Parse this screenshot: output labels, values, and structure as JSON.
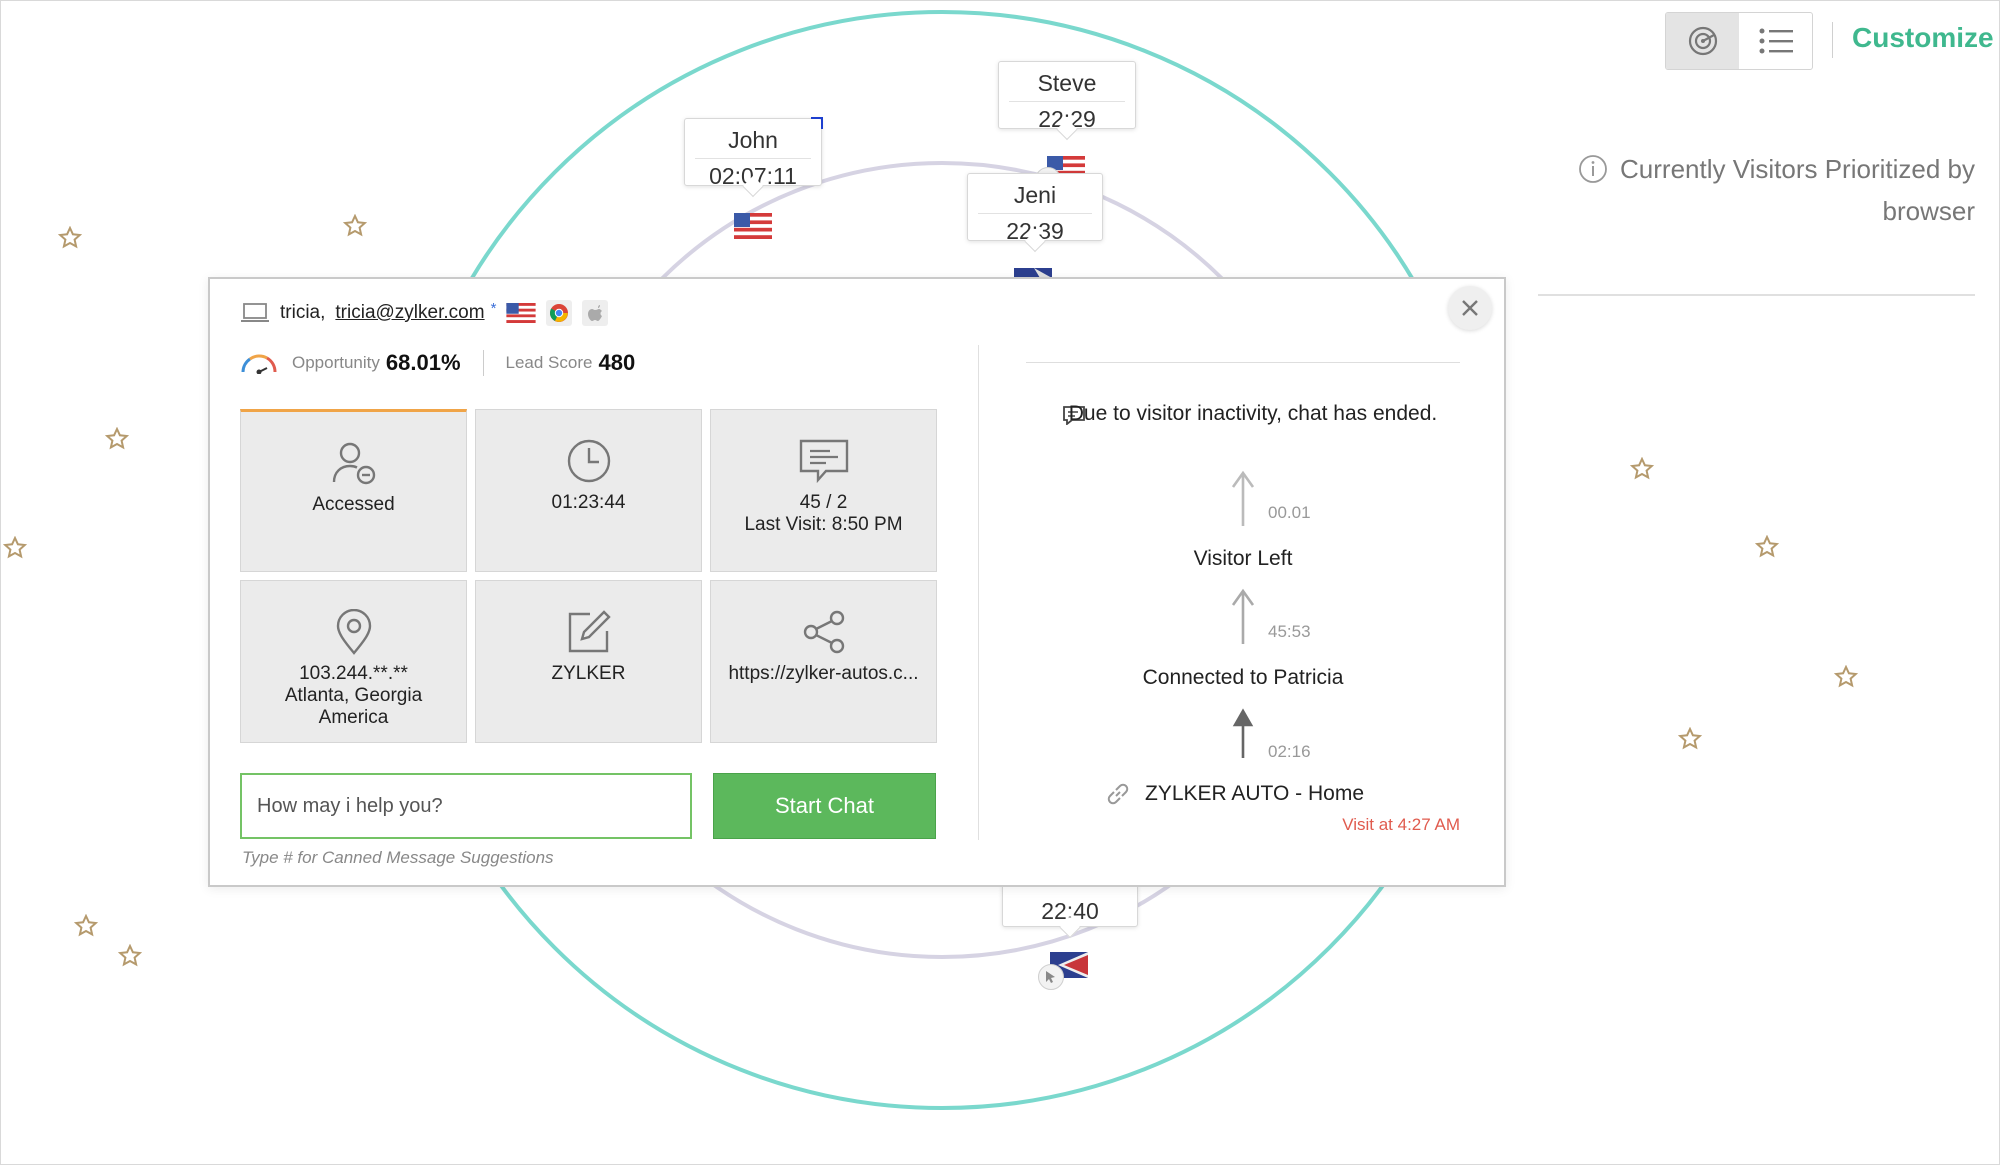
{
  "colors": {
    "accent": "#3fb88e",
    "outer_ring": "#7ad8cd",
    "inner_ring": "#d6d3e3",
    "start_chat": "#5cb85c",
    "input_border": "#74c365",
    "active_tile": "#f0a447",
    "visit_time": "#e05b4e"
  },
  "toolbar": {
    "customize_label": "Customize",
    "view_radar_icon": "radar-icon",
    "view_list_icon": "list-icon"
  },
  "priority": {
    "line1": "Currently Visitors Prioritized by",
    "line2": "browser",
    "icon": "info-icon"
  },
  "radar_visitors": [
    {
      "name": "John",
      "time": "02:07:11"
    },
    {
      "name": "Steve",
      "time": "22:29"
    },
    {
      "name": "Jeni",
      "time": "22:39"
    },
    {
      "name": "",
      "time": "22:40"
    }
  ],
  "visitor": {
    "name": "tricia,",
    "email": "tricia@zylker.com",
    "asterisk": "*",
    "device_icon": "laptop-icon",
    "flag_icon": "us-flag-icon",
    "browser_icon": "chrome-icon",
    "os_icon": "apple-icon"
  },
  "scores": {
    "opportunity_label": "Opportunity",
    "opportunity_value": "68.01%",
    "lead_label": "Lead Score",
    "lead_value": "480"
  },
  "tiles": [
    {
      "icon": "user-minus-icon",
      "lines": [
        "Accessed"
      ]
    },
    {
      "icon": "clock-icon",
      "lines": [
        "01:23:44"
      ]
    },
    {
      "icon": "chat-icon",
      "lines": [
        "45 / 2",
        "Last Visit: 8:50 PM"
      ]
    },
    {
      "icon": "location-icon",
      "lines": [
        "103.244.**.**",
        "Atlanta, Georgia",
        "America"
      ]
    },
    {
      "icon": "edit-icon",
      "lines": [
        "ZYLKER"
      ]
    },
    {
      "icon": "share-icon",
      "lines": [
        "https://zylker-autos.c..."
      ]
    }
  ],
  "chat": {
    "placeholder": "How may i help you?",
    "start_label": "Start Chat",
    "hint": "Type # for Canned Message Suggestions"
  },
  "timeline": {
    "ended": "Due to visitor inactivity, chat has ended.",
    "t1": "00.01",
    "left": "Visitor Left",
    "t2": "45:53",
    "connected": "Connected to Patricia",
    "t3": "02:16",
    "page": "ZYLKER AUTO - Home",
    "visit_at": "Visit at 4:27 AM"
  }
}
